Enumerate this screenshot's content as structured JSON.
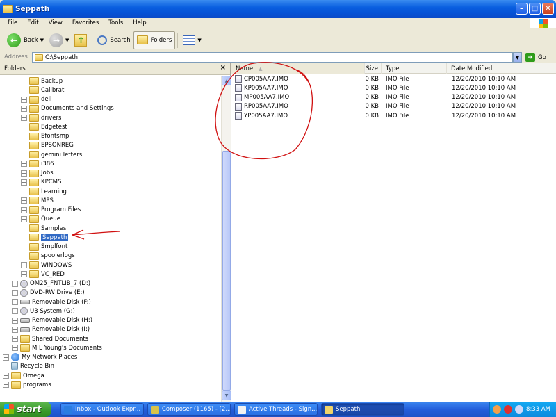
{
  "window": {
    "title": "Seppath"
  },
  "menu": [
    "File",
    "Edit",
    "View",
    "Favorites",
    "Tools",
    "Help"
  ],
  "toolbar": {
    "back": "Back",
    "search": "Search",
    "folders": "Folders"
  },
  "address": {
    "label": "Address",
    "value": "C:\\Seppath",
    "go": "Go"
  },
  "folders_pane": {
    "title": "Folders"
  },
  "tree": [
    {
      "label": "Backup",
      "depth": 3,
      "expander": false,
      "icon": "folder"
    },
    {
      "label": "Calibrat",
      "depth": 3,
      "expander": false,
      "icon": "folder"
    },
    {
      "label": "dell",
      "depth": 3,
      "expander": true,
      "icon": "folder"
    },
    {
      "label": "Documents and Settings",
      "depth": 3,
      "expander": true,
      "icon": "folder"
    },
    {
      "label": "drivers",
      "depth": 3,
      "expander": true,
      "icon": "folder"
    },
    {
      "label": "Edgetest",
      "depth": 3,
      "expander": false,
      "icon": "folder"
    },
    {
      "label": "Efontsmp",
      "depth": 3,
      "expander": false,
      "icon": "folder"
    },
    {
      "label": "EPSONREG",
      "depth": 3,
      "expander": false,
      "icon": "folder"
    },
    {
      "label": "gemini letters",
      "depth": 3,
      "expander": false,
      "icon": "folder"
    },
    {
      "label": "i386",
      "depth": 3,
      "expander": true,
      "icon": "folder"
    },
    {
      "label": "Jobs",
      "depth": 3,
      "expander": true,
      "icon": "folder"
    },
    {
      "label": "KPCMS",
      "depth": 3,
      "expander": true,
      "icon": "folder"
    },
    {
      "label": "Learning",
      "depth": 3,
      "expander": false,
      "icon": "folder"
    },
    {
      "label": "MPS",
      "depth": 3,
      "expander": true,
      "icon": "folder"
    },
    {
      "label": "Program Files",
      "depth": 3,
      "expander": true,
      "icon": "folder"
    },
    {
      "label": "Queue",
      "depth": 3,
      "expander": true,
      "icon": "folder"
    },
    {
      "label": "Samples",
      "depth": 3,
      "expander": false,
      "icon": "folder"
    },
    {
      "label": "Seppath",
      "depth": 3,
      "expander": false,
      "icon": "folder-open",
      "selected": true
    },
    {
      "label": "Smplfont",
      "depth": 3,
      "expander": false,
      "icon": "folder"
    },
    {
      "label": "spoolerlogs",
      "depth": 3,
      "expander": false,
      "icon": "folder"
    },
    {
      "label": "WINDOWS",
      "depth": 3,
      "expander": true,
      "icon": "folder"
    },
    {
      "label": "VC_RED",
      "depth": 3,
      "expander": true,
      "icon": "folder"
    },
    {
      "label": "OM25_FNTLIB_7 (D:)",
      "depth": 2,
      "expander": true,
      "icon": "cd"
    },
    {
      "label": "DVD-RW Drive (E:)",
      "depth": 2,
      "expander": true,
      "icon": "cd"
    },
    {
      "label": "Removable Disk (F:)",
      "depth": 2,
      "expander": true,
      "icon": "drive"
    },
    {
      "label": "U3 System (G:)",
      "depth": 2,
      "expander": true,
      "icon": "cd"
    },
    {
      "label": "Removable Disk (H:)",
      "depth": 2,
      "expander": true,
      "icon": "drive"
    },
    {
      "label": "Removable Disk (I:)",
      "depth": 2,
      "expander": true,
      "icon": "drive"
    },
    {
      "label": "Shared Documents",
      "depth": 2,
      "expander": true,
      "icon": "folder"
    },
    {
      "label": "M L Young's Documents",
      "depth": 2,
      "expander": true,
      "icon": "folder"
    },
    {
      "label": "My Network Places",
      "depth": 1,
      "expander": true,
      "icon": "network"
    },
    {
      "label": "Recycle Bin",
      "depth": 1,
      "expander": false,
      "icon": "bin"
    },
    {
      "label": "Omega",
      "depth": 1,
      "expander": true,
      "icon": "folder"
    },
    {
      "label": "programs",
      "depth": 1,
      "expander": true,
      "icon": "folder"
    }
  ],
  "list": {
    "columns": [
      "Name",
      "Size",
      "Type",
      "Date Modified"
    ],
    "rows": [
      {
        "name": "CP005AA7.IMO",
        "size": "0 KB",
        "type": "IMO File",
        "date": "12/20/2010 10:10 AM"
      },
      {
        "name": "KP005AA7.IMO",
        "size": "0 KB",
        "type": "IMO File",
        "date": "12/20/2010 10:10 AM"
      },
      {
        "name": "MP005AA7.IMO",
        "size": "0 KB",
        "type": "IMO File",
        "date": "12/20/2010 10:10 AM"
      },
      {
        "name": "RP005AA7.IMO",
        "size": "0 KB",
        "type": "IMO File",
        "date": "12/20/2010 10:10 AM"
      },
      {
        "name": "YP005AA7.IMO",
        "size": "0 KB",
        "type": "IMO File",
        "date": "12/20/2010 10:10 AM"
      }
    ]
  },
  "taskbar": {
    "start": "start",
    "tasks": [
      {
        "label": "Inbox - Outlook Expr...",
        "icon": "#2a7de1"
      },
      {
        "label": "Composer (1165) - [2...",
        "icon": "#d9c24a"
      },
      {
        "label": "Active Threads - Sign...",
        "icon": "#f2f2f2"
      },
      {
        "label": "Seppath",
        "icon": "#f0d36a",
        "active": true
      }
    ],
    "clock": "8:33 AM"
  },
  "colors": {
    "selection": "#316ac5",
    "title": "#0552d6",
    "annotation": "#d01010"
  }
}
